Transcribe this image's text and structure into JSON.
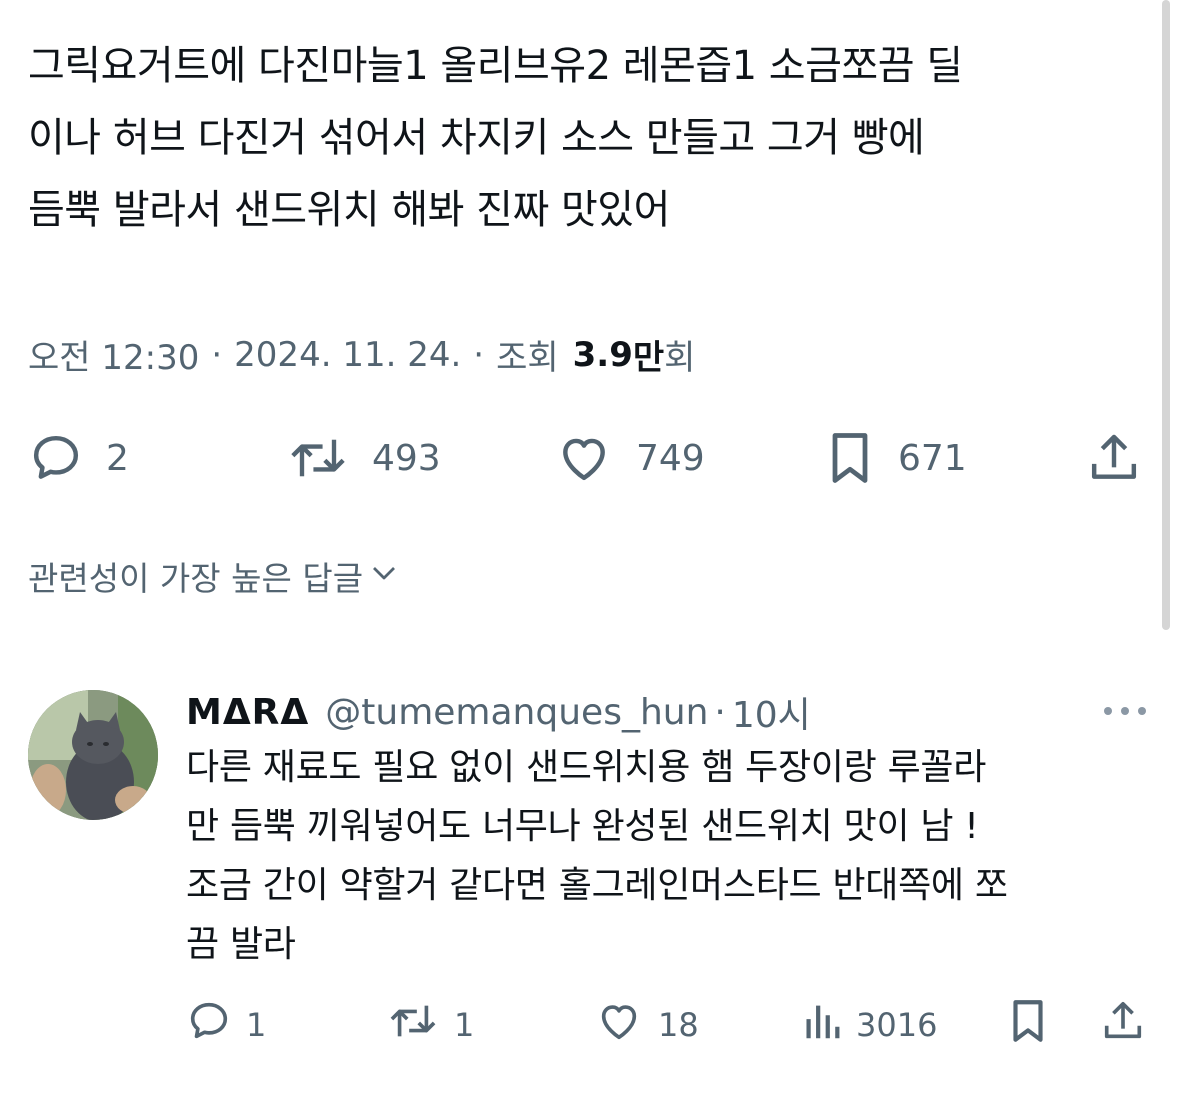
{
  "tweet": {
    "lines": [
      "그릭요거트에 다진마늘1 올리브유2 레몬즙1 소금쪼끔 딜",
      "이나 허브 다진거 섞어서 차지키 소스 만들고 그거 빵에",
      "듬뿍 발라서 샌드위치 해봐 진짜 맛있어"
    ],
    "time": "오전 12:30",
    "date": "2024. 11. 24.",
    "views_label": "조회",
    "views_num": "3.9",
    "views_unit": "만",
    "views_suffix": "회",
    "separator": "·"
  },
  "actions": {
    "replies": "2",
    "retweets": "493",
    "likes": "749",
    "bookmarks": "671"
  },
  "replies_sort": {
    "label": "관련성이 가장 높은 답글"
  },
  "reply": {
    "name": "MΔRΔ",
    "handle": "@tumemanques_hun",
    "time": "10시",
    "separator": "·",
    "lines": [
      "다른 재료도 필요 없이 샌드위치용 햄 두장이랑 루꼴라",
      "만 듬뿍 끼워넣어도 너무나 완성된 샌드위치 맛이 남 !",
      "조금 간이 약할거 같다면 홀그레인머스타드 반대쪽에 쪼",
      "끔 발라"
    ],
    "actions": {
      "replies": "1",
      "retweets": "1",
      "likes": "18",
      "views": "3016"
    }
  },
  "colors": {
    "text": "#0f1419",
    "secondary": "#536471",
    "background": "#ffffff"
  },
  "icons": [
    "reply-icon",
    "retweet-icon",
    "like-icon",
    "bookmark-icon",
    "share-icon",
    "chevron-down-icon",
    "more-icon",
    "views-icon"
  ]
}
